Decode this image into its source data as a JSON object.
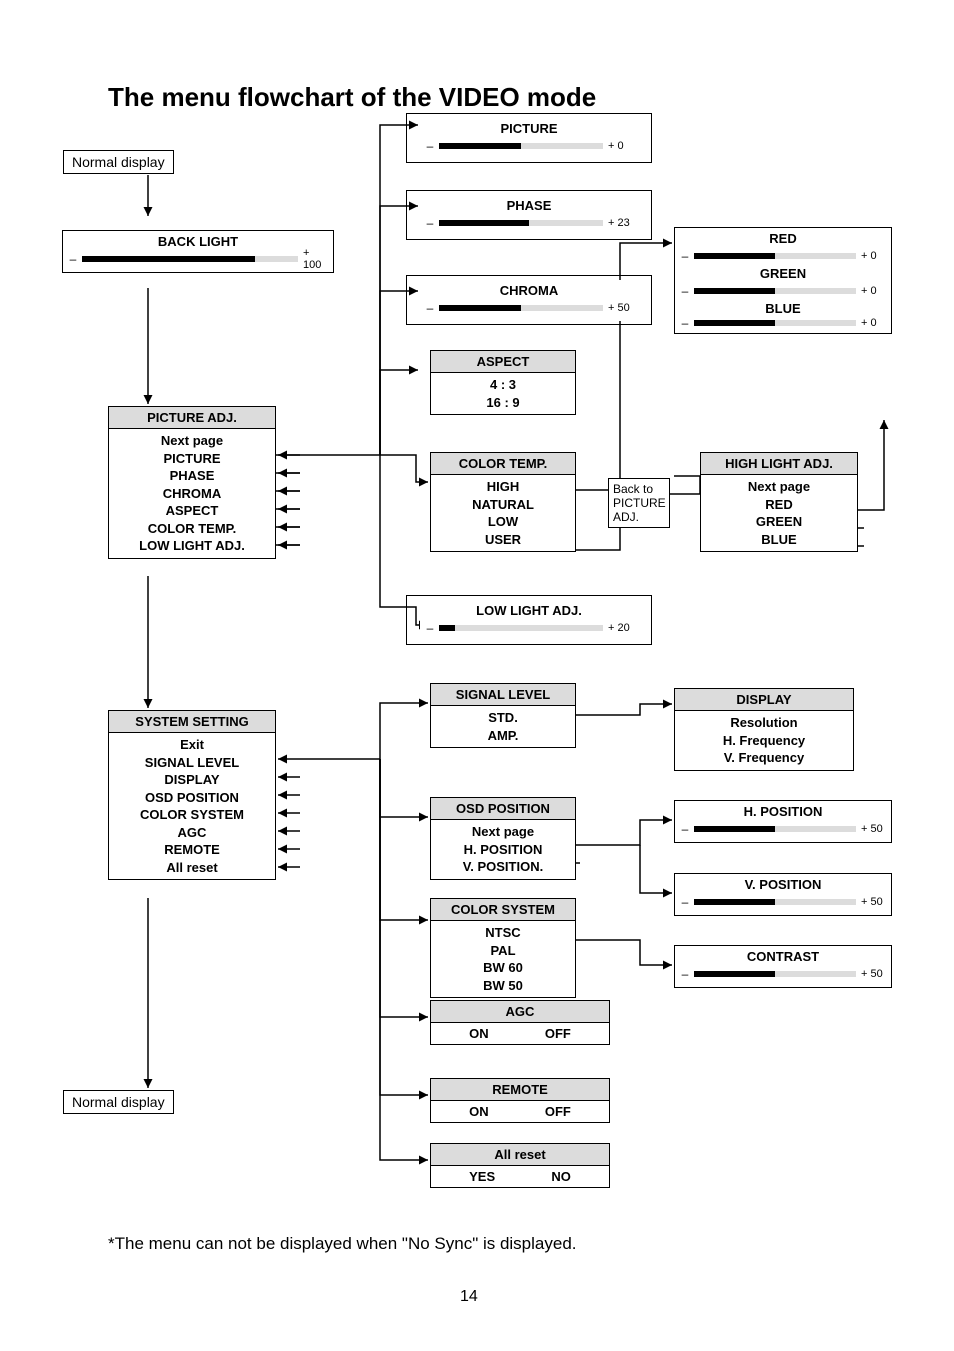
{
  "title": "The menu flowchart of the VIDEO mode",
  "normal_display_top": "Normal display",
  "normal_display_bottom": "Normal display",
  "back_light": {
    "title": "BACK LIGHT",
    "val": "+ 100",
    "fill": 80
  },
  "picture_adj": {
    "title": "PICTURE ADJ.",
    "items": [
      "Next page",
      "PICTURE",
      "PHASE",
      "CHROMA",
      "ASPECT",
      "COLOR TEMP.",
      "LOW LIGHT ADJ."
    ]
  },
  "system_setting": {
    "title": "SYSTEM SETTING",
    "items": [
      "Exit",
      "SIGNAL LEVEL",
      "DISPLAY",
      "OSD POSITION",
      "COLOR SYSTEM",
      "AGC",
      "REMOTE",
      "All reset"
    ]
  },
  "picture": {
    "title": "PICTURE",
    "val": "+  0",
    "fill": 50
  },
  "phase": {
    "title": "PHASE",
    "val": "+ 23",
    "fill": 55
  },
  "chroma": {
    "title": "CHROMA",
    "val": "+ 50",
    "fill": 50
  },
  "aspect": {
    "title": "ASPECT",
    "items": [
      "4 : 3",
      "16 : 9"
    ]
  },
  "color_temp": {
    "title": "COLOR TEMP.",
    "items": [
      "HIGH",
      "NATURAL",
      "LOW",
      "USER"
    ]
  },
  "low_light": {
    "title": "LOW LIGHT ADJ.",
    "val": "+ 20",
    "fill": 10
  },
  "rgb": {
    "red": {
      "title": "RED",
      "val": "+  0",
      "fill": 50
    },
    "green": {
      "title": "GREEN",
      "val": "+  0",
      "fill": 50
    },
    "blue": {
      "title": "BLUE",
      "val": "+  0",
      "fill": 50
    }
  },
  "high_light_adj": {
    "title": "HIGH LIGHT ADJ.",
    "items": [
      "Next page",
      "RED",
      "GREEN",
      "BLUE"
    ]
  },
  "back_note": "Back to PICTURE ADJ.",
  "signal_level": {
    "title": "SIGNAL LEVEL",
    "items": [
      "STD.",
      "AMP."
    ]
  },
  "display": {
    "title": "DISPLAY",
    "items": [
      "Resolution",
      "H. Frequency",
      "V. Frequency"
    ]
  },
  "osd_position": {
    "title": "OSD POSITION",
    "items": [
      "Next page",
      "H. POSITION",
      "V. POSITION."
    ]
  },
  "h_position": {
    "title": "H. POSITION",
    "val": "+ 50",
    "fill": 50
  },
  "v_position": {
    "title": "V. POSITION",
    "val": "+ 50",
    "fill": 50
  },
  "contrast": {
    "title": "CONTRAST",
    "val": "+ 50",
    "fill": 50
  },
  "color_system": {
    "title": "COLOR SYSTEM",
    "items": [
      "NTSC",
      "PAL",
      "BW 60",
      "BW 50"
    ]
  },
  "agc": {
    "title": "AGC",
    "on": "ON",
    "off": "OFF"
  },
  "remote": {
    "title": "REMOTE",
    "on": "ON",
    "off": "OFF"
  },
  "all_reset": {
    "title": "All reset",
    "yes": "YES",
    "no": "NO"
  },
  "footnote": "*The menu can not be displayed when \"No Sync\" is displayed.",
  "page_num": "14"
}
